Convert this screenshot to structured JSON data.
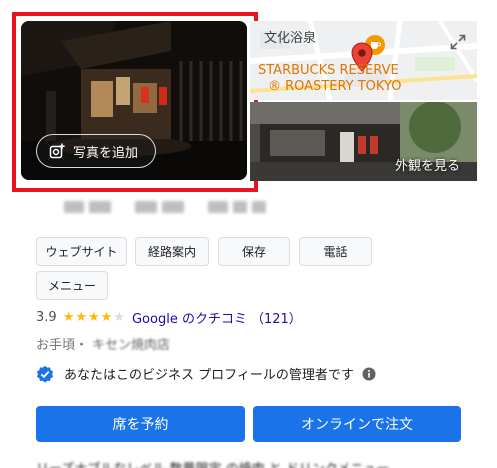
{
  "photos": {
    "add_photo_label": "写真を追加",
    "exterior_label": "外観を見る"
  },
  "map": {
    "area_label": "文化浴泉",
    "store_line1": "STARBUCKS RESERVE",
    "store_line2": "® ROASTERY TOKYO"
  },
  "actions": [
    {
      "label": "ウェブサイト"
    },
    {
      "label": "経路案内"
    },
    {
      "label": "保存"
    },
    {
      "label": "電話"
    },
    {
      "label": "メニュー"
    }
  ],
  "rating": {
    "score": "3.9",
    "stars": 4,
    "reviews_label": "Google のクチコミ",
    "reviews_count": "（121）"
  },
  "category": {
    "price": "お手頃",
    "separator": "・",
    "type": "キセン焼肉店"
  },
  "owner_notice": "あなたはこのビジネス プロフィールの管理者です",
  "buttons": {
    "reserve": "席を予約",
    "order_online": "オンラインで注文"
  },
  "description_cutoff": "リーズナブルなレベル 数量限定 の焼肉 と ドリンクメニュー"
}
